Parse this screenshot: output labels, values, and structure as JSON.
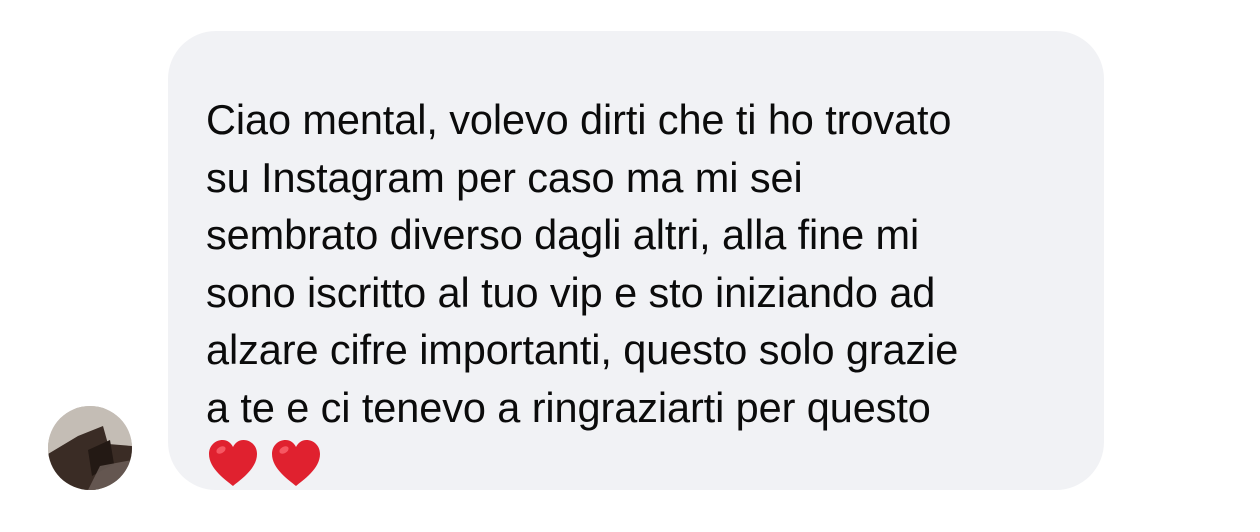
{
  "message": {
    "text": "Ciao mental, volevo dirti che ti ho trovato\nsu Instagram per caso ma mi sei\nsembrato diverso dagli altri, alla fine mi\nsono iscritto al tuo vip e sto iniziando ad\nalzare cifre importanti, questo solo grazie\na te e ci tenevo a ringraziarti per questo",
    "emojis": [
      "red-heart-icon",
      "red-heart-icon"
    ]
  },
  "colors": {
    "bubble_background": "#f1f2f5",
    "text": "#0b0b0b",
    "heart": "#e0212f"
  }
}
